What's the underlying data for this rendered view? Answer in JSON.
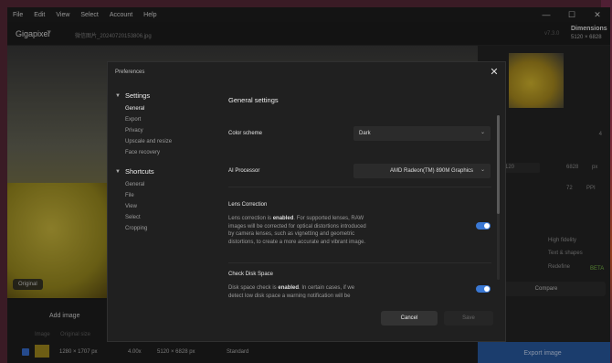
{
  "menubar": {
    "items": [
      "File",
      "Edit",
      "View",
      "Select",
      "Account",
      "Help"
    ]
  },
  "window_controls": {
    "minimize": "—",
    "maximize": "☐",
    "close": "✕"
  },
  "titlebar": {
    "app_name": "Gigapixel",
    "app_version": "7",
    "file_name": "微信图片_20240720153806.jpg",
    "version_badge": "v7.3.0",
    "dimensions_label": "Dimensions",
    "dimensions_value": "5120 × 6828"
  },
  "canvas": {
    "original_badge": "Original"
  },
  "right_panel": {
    "scale_value": "4",
    "width_value": "120",
    "height_value": "6828",
    "px_unit": "px",
    "ppi_value": "72",
    "ppi_unit": "PPI",
    "option_1": "High fidelity",
    "option_2": "Text & shapes",
    "option_3": "Redefine",
    "beta_label": "BETA",
    "compare_label": "Compare",
    "export_label": "Export image"
  },
  "bottom_bar": {
    "add_image_label": "Add image",
    "headers": [
      "Image",
      "Original size"
    ],
    "row": {
      "original": "1280 × 1707 px",
      "scale": "4.00x",
      "output": "5120 × 6828 px",
      "model": "Standard"
    }
  },
  "dialog": {
    "title": "Preferences",
    "nav": {
      "settings_header": "Settings",
      "settings_items": [
        "General",
        "Export",
        "Privacy",
        "Upscale and resize",
        "Face recovery"
      ],
      "shortcuts_header": "Shortcuts",
      "shortcuts_items": [
        "General",
        "File",
        "View",
        "Select",
        "Cropping"
      ]
    },
    "content": {
      "section_title": "General settings",
      "color_scheme_label": "Color scheme",
      "color_scheme_value": "Dark",
      "ai_processor_label": "AI Processor",
      "ai_processor_value": "AMD Radeon(TM) 890M Graphics",
      "lens_title": "Lens Correction",
      "lens_pre": "Lens correction is ",
      "lens_state": "enabled",
      "lens_post": ". For supported lenses, RAW images will be corrected for optical distortions introduced by camera lenses, such as vignetting and geometric distortions, to create a more accurate and vibrant image.",
      "lens_enabled": true,
      "disk_title": "Check Disk Space",
      "disk_pre": "Disk space check is ",
      "disk_state": "enabled",
      "disk_post": ". In certain cases, if we detect low disk space a warning notification will be",
      "disk_enabled": true
    },
    "buttons": {
      "cancel": "Cancel",
      "save": "Save"
    }
  },
  "colors": {
    "accent_blue": "#3a78d4",
    "export_blue": "#2a5fa8",
    "beta_green": "#7fc24a"
  }
}
